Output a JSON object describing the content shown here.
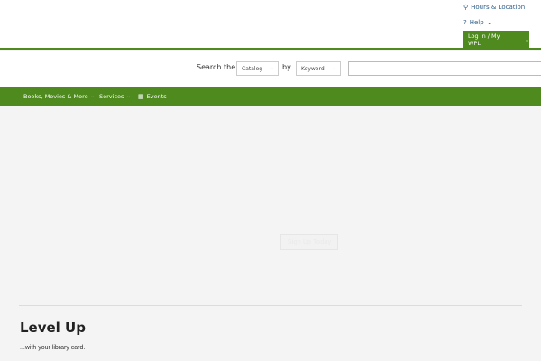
{
  "header": {
    "utility_links": [
      {
        "icon": "map-marker-icon",
        "glyph": "⚲",
        "label": "Hours & Location"
      },
      {
        "icon": "question-circle-icon",
        "glyph": "?",
        "label": "Help",
        "chevron": "⌄"
      }
    ],
    "login": {
      "label": "Log In / My WPL",
      "chevron": "⌄"
    }
  },
  "search": {
    "label_search_the": "Search the",
    "label_by": "by",
    "scope_select": {
      "value": "Catalog",
      "caret": "⌄"
    },
    "type_select": {
      "value": "Keyword",
      "caret": "⌄"
    },
    "query_value": ""
  },
  "nav": {
    "items": [
      {
        "label": "Books, Movies & More",
        "chevron": "⌄"
      },
      {
        "label": "Services",
        "chevron": "⌄"
      },
      {
        "label": "Events",
        "icon": "calendar-icon",
        "glyph": "▦"
      }
    ]
  },
  "hero": {
    "button_label": "Sign Up Today"
  },
  "promo": {
    "title": "Level Up",
    "subtitle": "...with your library card."
  },
  "colors": {
    "brand_green": "#4e8a1e",
    "link_blue": "#2f5f8a",
    "page_bg": "#f4f4f4"
  }
}
